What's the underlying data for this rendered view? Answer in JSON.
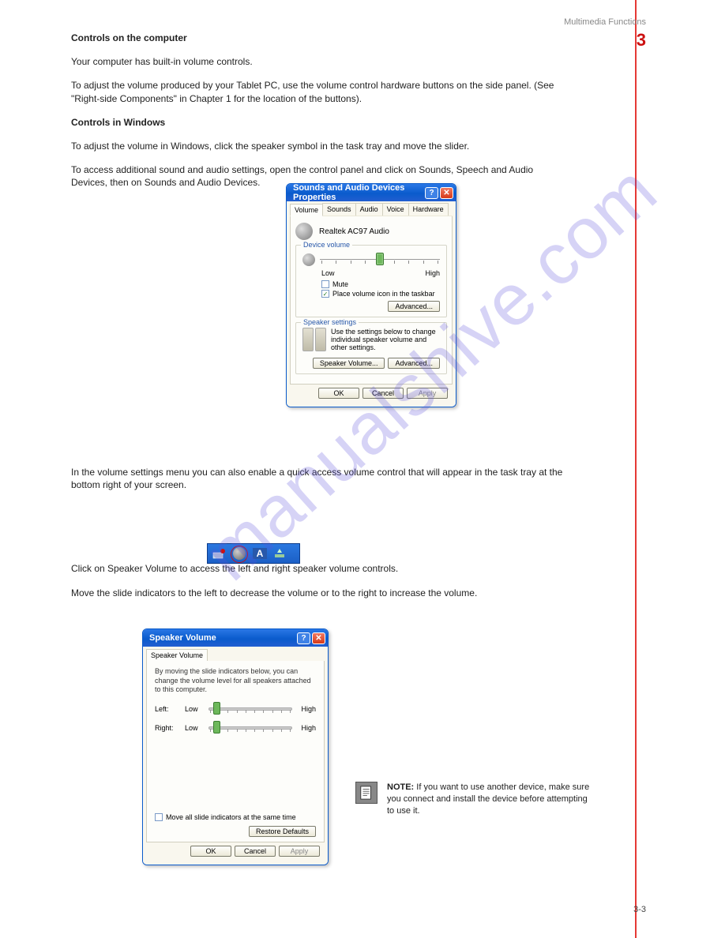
{
  "watermark": "manualshive.com",
  "page": {
    "heading": "Multimedia Functions",
    "section_number": "3",
    "subheading": "Controls on the computer",
    "intro_text": "Your computer has built-in volume controls.",
    "intro_instr": "To adjust the volume produced by your Tablet PC, use the volume control hardware buttons on the side panel. (See \"Right-side Components\" in Chapter 1 for the location of the buttons).",
    "section_controls_in_windows": "Controls in Windows",
    "win_instr": "To adjust the volume in Windows, click the speaker symbol in the task tray and move the slider.",
    "access_settings_instr": "To access additional sound and audio settings, open the control panel and click on Sounds, Speech and Audio Devices, then on Sounds and Audio Devices.",
    "tray_instr": "In the volume settings menu you can also enable a quick access volume control that will appear in the task tray at the bottom right of your screen.",
    "speaker_vol_instr1": "Click on Speaker Volume to access the left and right speaker volume controls.",
    "speaker_vol_instr2": "Move the slide indicators to the left to decrease the volume or to the right to increase the volume.",
    "note_label": "NOTE:",
    "note_text": "If you want to use another device, make sure you connect and install the device before attempting to use it.",
    "page_number": "3-3"
  },
  "dialog1": {
    "title": "Sounds and Audio Devices Properties",
    "tabs": [
      "Volume",
      "Sounds",
      "Audio",
      "Voice",
      "Hardware"
    ],
    "device_name": "Realtek AC97 Audio",
    "fieldset_device_volume": "Device volume",
    "slider_low": "Low",
    "slider_high": "High",
    "chk_mute": "Mute",
    "chk_taskbar": "Place volume icon in the taskbar",
    "btn_advanced1": "Advanced...",
    "fieldset_speaker": "Speaker settings",
    "speaker_text": "Use the settings below to change individual speaker volume and other settings.",
    "btn_speaker_volume": "Speaker Volume...",
    "btn_advanced2": "Advanced...",
    "btn_ok": "OK",
    "btn_cancel": "Cancel",
    "btn_apply": "Apply"
  },
  "tray": {
    "language_indicator": "A"
  },
  "dialog2": {
    "title": "Speaker Volume",
    "tab": "Speaker Volume",
    "desc": "By moving the slide indicators below, you can change the volume level for all speakers attached to this computer.",
    "left_label": "Left:",
    "right_label": "Right:",
    "low": "Low",
    "high": "High",
    "chk_move_all": "Move all slide indicators at the same time",
    "btn_restore": "Restore Defaults",
    "btn_ok": "OK",
    "btn_cancel": "Cancel",
    "btn_apply": "Apply"
  }
}
